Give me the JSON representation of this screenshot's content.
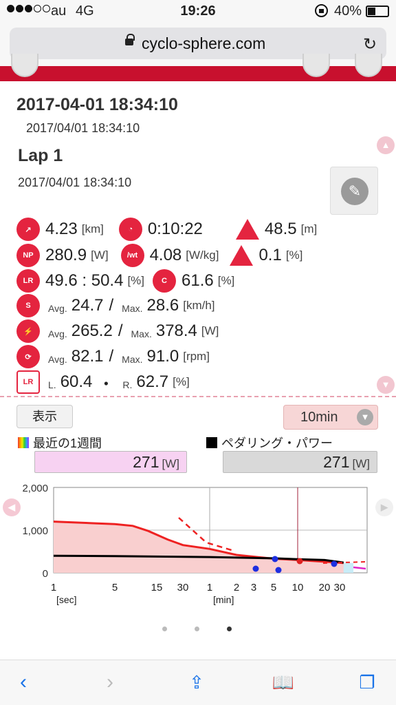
{
  "status": {
    "carrier": "au",
    "network": "4G",
    "time": "19:26",
    "battery": "40%",
    "battery_level": 0.4
  },
  "browser": {
    "url": "cyclo-sphere.com",
    "reload_icon": "↻"
  },
  "activity": {
    "title": "2017-04-01 18:34:10",
    "subtitle": "2017/04/01 18:34:10"
  },
  "lap": {
    "title": "Lap 1",
    "time": "2017/04/01 18:34:10"
  },
  "stats": {
    "distance": {
      "value": "4.23",
      "unit": "[km]"
    },
    "duration": {
      "value": "0:10:22"
    },
    "elevation": {
      "value": "48.5",
      "unit": "[m]"
    },
    "np": {
      "icon": "NP",
      "value": "280.9",
      "unit": "[W]"
    },
    "pwr_weight": {
      "icon": "/wt",
      "value": "4.08",
      "unit": "[W/kg]"
    },
    "grade": {
      "value": "0.1",
      "unit": "[%]"
    },
    "lr": {
      "icon": "LR",
      "value": "49.6 : 50.4",
      "unit": "[%]"
    },
    "efficiency": {
      "icon": "C",
      "value": "61.6",
      "unit": "[%]"
    },
    "speed": {
      "icon": "S",
      "avg_label": "Avg.",
      "avg": "24.7",
      "slash": "/",
      "max_label": "Max.",
      "max": "28.6",
      "unit": "[km/h]"
    },
    "power": {
      "avg_label": "Avg.",
      "avg": "265.2",
      "slash": "/",
      "max_label": "Max.",
      "max": "378.4",
      "unit": "[W]"
    },
    "cadence": {
      "avg_label": "Avg.",
      "avg": "82.1",
      "slash": "/",
      "max_label": "Max.",
      "max": "91.0",
      "unit": "[rpm]"
    },
    "lr_eff": {
      "icon": "LR",
      "l_label": "L.",
      "l": "60.4",
      "dot": "・",
      "r_label": "R.",
      "r": "62.7",
      "unit": "[%]"
    }
  },
  "controls": {
    "show_button": "表示",
    "range_value": "10min"
  },
  "legend": {
    "week": {
      "label": "最近の1週間",
      "value": "271",
      "unit": "[W]"
    },
    "pedal": {
      "label": "ペダリング・パワー",
      "value": "271",
      "unit": "[W]"
    }
  },
  "colors": {
    "brand": "#c8102e",
    "accent": "#e4243f",
    "curve_red": "#ee2222",
    "week_box": "#f7d2f2",
    "pedal_box": "#d9d9d9"
  },
  "chart_data": {
    "type": "line",
    "title": "",
    "ylim": [
      0,
      2000
    ],
    "yticks": [
      "2,000",
      "1,000",
      "0"
    ],
    "xticks": [
      "1",
      "5",
      "15",
      "30",
      "1",
      "2",
      "3",
      "5",
      "10",
      "20",
      "30"
    ],
    "xunits": [
      "[sec]",
      "[min]"
    ],
    "x_seconds": [
      1,
      5,
      15,
      30,
      60,
      120,
      180,
      300,
      600,
      1200,
      1800
    ],
    "series": [
      {
        "x": [
          1,
          3,
          5,
          8,
          12,
          20,
          30,
          60,
          120,
          300,
          600,
          1200,
          2000
        ],
        "values": [
          1200,
          1160,
          1140,
          1100,
          980,
          780,
          650,
          560,
          420,
          330,
          300,
          260,
          230
        ]
      },
      {
        "x": [
          1,
          5,
          15,
          60,
          300,
          600,
          1200,
          2000
        ],
        "values": [
          400,
          390,
          380,
          370,
          340,
          320,
          300,
          240
        ]
      }
    ],
    "grid": true
  },
  "pager": {
    "pages": 3,
    "active": 2
  }
}
